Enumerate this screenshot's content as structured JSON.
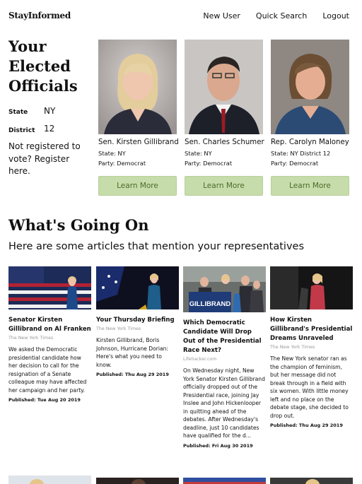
{
  "nav": {
    "brand": "StayInformed",
    "links": [
      "New User",
      "Quick Search",
      "Logout"
    ]
  },
  "officials": {
    "heading": "Your Elected Officials",
    "state_label": "State",
    "state_value": "NY",
    "district_label": "District",
    "district_value": "12",
    "register_text": "Not registered to vote? Register here.",
    "button_label": "Learn More",
    "cards": [
      {
        "name": "Sen. Kirsten Gillibrand",
        "state": "State: NY",
        "party": "Party: Democrat"
      },
      {
        "name": "Sen. Charles Schumer",
        "state": "State: NY",
        "party": "Party: Democrat"
      },
      {
        "name": "Rep. Carolyn Maloney",
        "state": "State: NY District 12",
        "party": "Party: Democrat"
      }
    ]
  },
  "news": {
    "title": "What's Going On",
    "subtitle": "Here are some articles that mention your representatives",
    "articles": [
      {
        "title": "Senator Kirsten Gillibrand on Al Franken",
        "source": "The New York Times",
        "body": "We asked the Democratic presidential candidate how her decision to call for the resignation of a Senate colleague may have affected her campaign and her party.",
        "date": "Published: Tue Aug 20 2019"
      },
      {
        "title": "Your Thursday Briefing",
        "source": "The New York Times",
        "body": "Kirsten Gillibrand, Boris Johnson, Hurricane Dorian: Here's what you need to know.",
        "date": "Published: Thu Aug 29 2019"
      },
      {
        "title": "Which Democratic Candidate Will Drop Out of the Presidential Race Next?",
        "source": "Lifehacker.com",
        "body": "On Wednesday night, New York Senator Kirsten Gillibrand officially dropped out of the Presidential race, joining Jay Inslee and John Hickenlooper in quitting ahead of the debates. After Wednesday's deadline, just 10 candidates have qualified for the d...",
        "date": "Published: Fri Aug 30 2019"
      },
      {
        "title": "How Kirsten Gillibrand's Presidential Dreams Unraveled",
        "source": "The New York Times",
        "body": "The New York senator ran as the champion of feminism, but her message did not break through in a field with six women. With little money left and no place on the debate stage, she decided to drop out.",
        "date": "Published: Thu Aug 29 2019"
      }
    ],
    "sign_text": "GILLIBRAND"
  },
  "colors": {
    "button_bg": "#c6dcaa",
    "button_text": "#4d6b2c"
  }
}
